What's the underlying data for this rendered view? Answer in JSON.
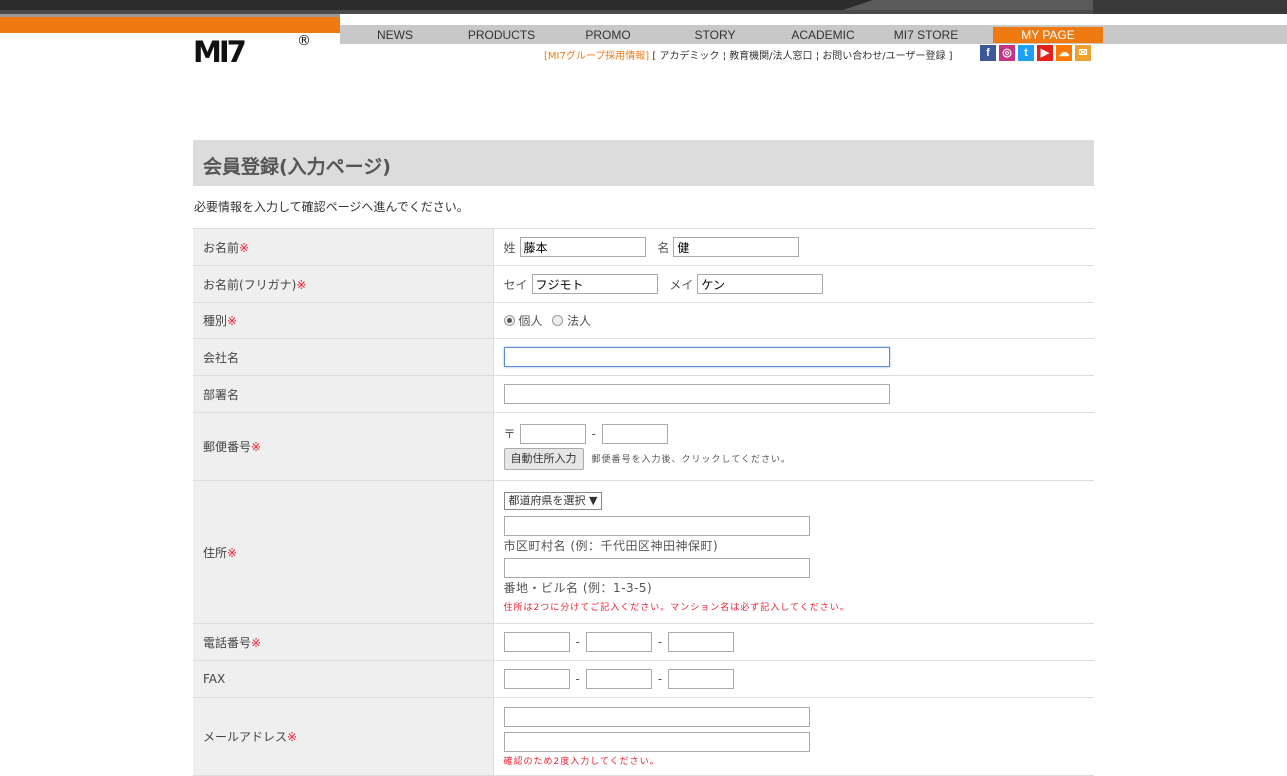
{
  "header": {
    "logo_text": "MI7",
    "logo_reg": "®",
    "nav": [
      {
        "label": "NEWS"
      },
      {
        "label": "PRODUCTS"
      },
      {
        "label": "PROMO"
      },
      {
        "label": "STORY"
      },
      {
        "label": "ACADEMIC"
      },
      {
        "label": "MI7 STORE"
      },
      {
        "label": "MY PAGE"
      }
    ],
    "subnav": {
      "recruit": "[MI7グループ採用情報]",
      "open": "[",
      "academic": "アカデミック",
      "sep1": "¦",
      "edu": "教育機関/法人窓口",
      "sep2": "¦",
      "contact": "お問い合わせ/ユーザー登録",
      "close": "]"
    },
    "social": [
      {
        "name": "facebook-icon",
        "glyph": "f",
        "color": "#3b5998"
      },
      {
        "name": "instagram-icon",
        "glyph": "◎",
        "color": "#c13584"
      },
      {
        "name": "twitter-icon",
        "glyph": "t",
        "color": "#1da1f2"
      },
      {
        "name": "youtube-icon",
        "glyph": "▶",
        "color": "#e62117"
      },
      {
        "name": "soundcloud-icon",
        "glyph": "☁",
        "color": "#ff7700"
      },
      {
        "name": "mail-icon",
        "glyph": "✉",
        "color": "#f0a030"
      }
    ]
  },
  "page": {
    "title": "会員登録(入力ページ)",
    "lead": "必要情報を入力して確認ページへ進んでください。"
  },
  "form": {
    "required_mark": "※",
    "name": {
      "label": "お名前",
      "sei_label": "姓",
      "sei_value": "藤本",
      "mei_label": "名",
      "mei_value": "健"
    },
    "kana": {
      "label": "お名前(フリガナ)",
      "sei_label": "セイ",
      "sei_value": "フジモト",
      "mei_label": "メイ",
      "mei_value": "ケン"
    },
    "type": {
      "label": "種別",
      "opt1": "個人",
      "opt2": "法人"
    },
    "company": {
      "label": "会社名",
      "value": ""
    },
    "dept": {
      "label": "部署名",
      "value": ""
    },
    "zip": {
      "label": "郵便番号",
      "mark": "〒",
      "dash": "-",
      "button": "自動住所入力",
      "hint": "郵便番号を入力後、クリックしてください。"
    },
    "address": {
      "label": "住所",
      "pref_select": "都道府県を選択 ▼",
      "city_hint": "市区町村名 (例：千代田区神田神保町)",
      "street_hint": "番地・ビル名 (例：1-3-5)",
      "note": "住所は2つに分けてご記入ください。マンション名は必ず記入してください。"
    },
    "tel": {
      "label": "電話番号",
      "dash": "-"
    },
    "fax": {
      "label": "FAX",
      "dash": "-"
    },
    "email": {
      "label": "メールアドレス",
      "note": "確認のため2度入力してください。"
    }
  }
}
